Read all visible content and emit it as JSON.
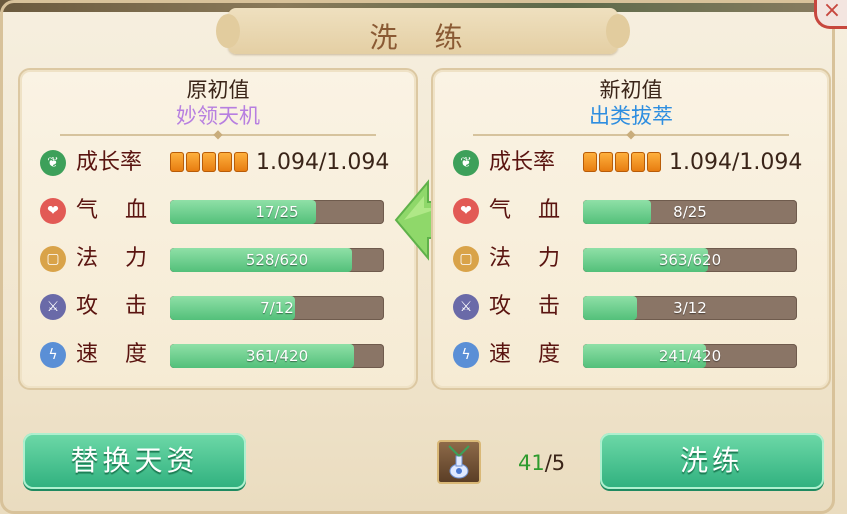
{
  "title": "洗 练",
  "original": {
    "heading": "原初值",
    "name": "妙领天机",
    "name_color": "#b77fe0",
    "growth": {
      "label": "成长率",
      "pips": 5,
      "value": "1.094/1.094"
    },
    "stats": [
      {
        "key": "hp",
        "label": "气 血",
        "icon": "heart-icon",
        "icon_color": "#e25a55",
        "value": 17,
        "max": 25,
        "text": "17/25"
      },
      {
        "key": "mp",
        "label": "法 力",
        "icon": "scroll-icon",
        "icon_color": "#d9a349",
        "value": 528,
        "max": 620,
        "text": "528/620"
      },
      {
        "key": "atk",
        "label": "攻 击",
        "icon": "sword-icon",
        "icon_color": "#6a6aa8",
        "value": 7,
        "max": 12,
        "text": "7/12"
      },
      {
        "key": "spd",
        "label": "速 度",
        "icon": "lightning-icon",
        "icon_color": "#5a8fd6",
        "value": 361,
        "max": 420,
        "text": "361/420"
      }
    ]
  },
  "new": {
    "heading": "新初值",
    "name": "出类拔萃",
    "name_color": "#2e8ee0",
    "growth": {
      "label": "成长率",
      "pips": 5,
      "value": "1.094/1.094"
    },
    "stats": [
      {
        "key": "hp",
        "label": "气 血",
        "icon": "heart-icon",
        "icon_color": "#e25a55",
        "value": 8,
        "max": 25,
        "text": "8/25"
      },
      {
        "key": "mp",
        "label": "法 力",
        "icon": "scroll-icon",
        "icon_color": "#d9a349",
        "value": 363,
        "max": 620,
        "text": "363/620"
      },
      {
        "key": "atk",
        "label": "攻 击",
        "icon": "sword-icon",
        "icon_color": "#6a6aa8",
        "value": 3,
        "max": 12,
        "text": "3/12"
      },
      {
        "key": "spd",
        "label": "速 度",
        "icon": "lightning-icon",
        "icon_color": "#5a8fd6",
        "value": 241,
        "max": 420,
        "text": "241/420"
      }
    ]
  },
  "buttons": {
    "replace": "替换天资",
    "wash": "洗练"
  },
  "item": {
    "icon": "potion-vase-icon",
    "have": "41",
    "need": "/5"
  },
  "colors": {
    "accent_green": "#2fb07e",
    "bar_fill": "#53c07a",
    "bar_track": "#8a7566",
    "growth_icon": "#3da05a"
  }
}
